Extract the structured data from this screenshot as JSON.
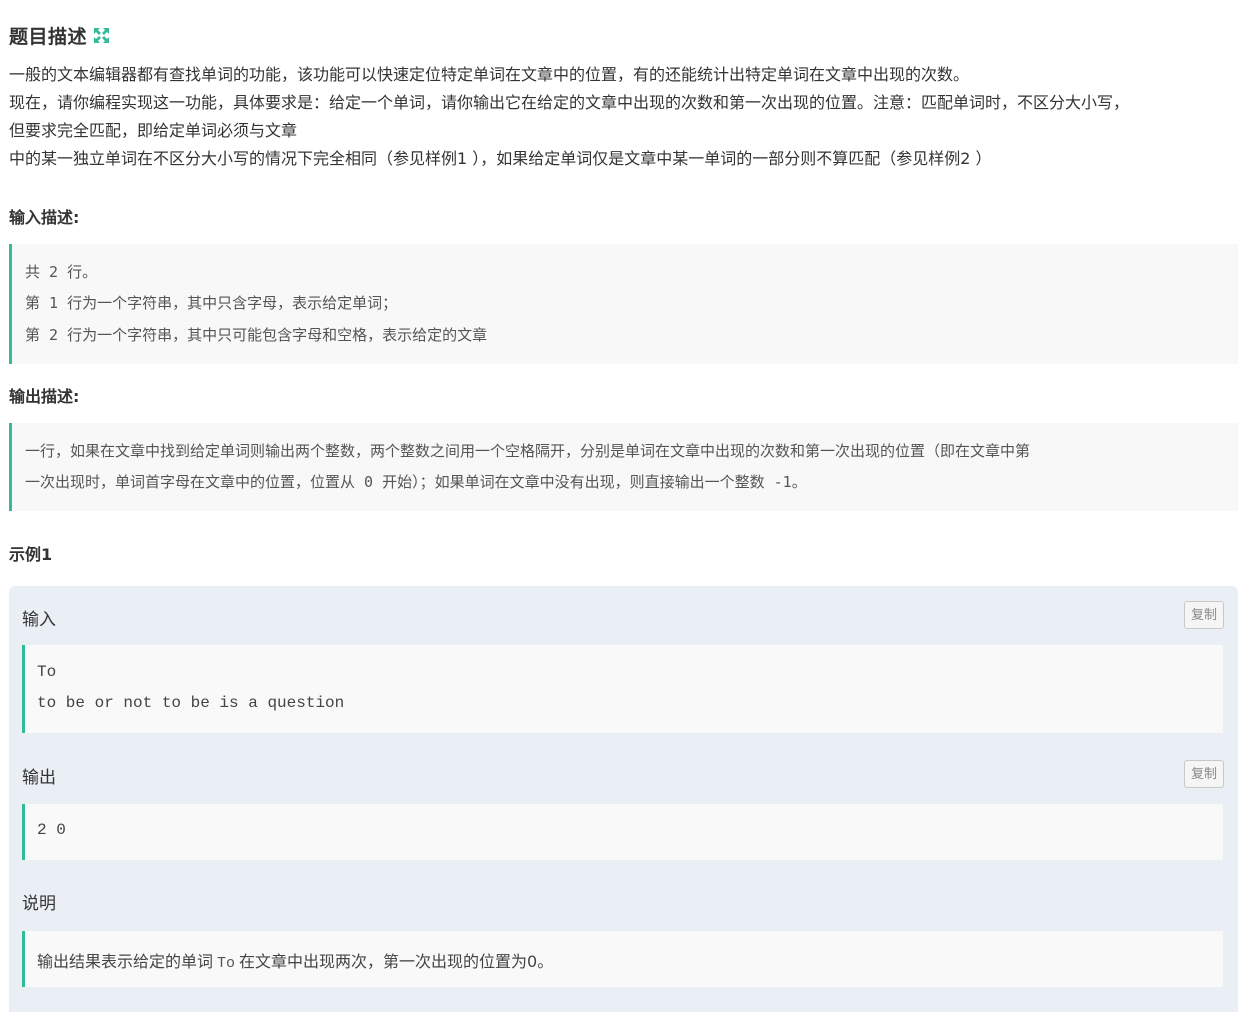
{
  "header": {
    "title": "题目描述",
    "expand_icon": "expand-arrows-icon",
    "accent_color": "#32ba9b"
  },
  "description": {
    "lines": [
      "一般的文本编辑器都有查找单词的功能，该功能可以快速定位特定单词在文章中的位置，有的还能统计出特定单词在文章中出现的次数。",
      "现在，请你编程实现这一功能，具体要求是：给定一个单词，请你输出它在给定的文章中出现的次数和第一次出现的位置。注意：匹配单词时，不区分大小写，",
      "但要求完全匹配，即给定单词必须与文章",
      "中的某一独立单词在不区分大小写的情况下完全相同（参见样例1 ），如果给定单词仅是文章中某一单词的一部分则不算匹配（参见样例2 ）"
    ]
  },
  "input_section": {
    "title": "输入描述:",
    "lines": [
      "共 2 行。",
      "第 1 行为一个字符串，其中只含字母，表示给定单词；",
      "第 2 行为一个字符串，其中只可能包含字母和空格，表示给定的文章"
    ]
  },
  "output_section": {
    "title": "输出描述:",
    "lines": [
      "一行，如果在文章中找到给定单词则输出两个整数，两个整数之间用一个空格隔开，分别是单词在文章中出现的次数和第一次出现的位置（即在文章中第",
      "一次出现时，单词首字母在文章中的位置，位置从 0 开始）；如果单词在文章中没有出现，则直接输出一个整数 -1。"
    ]
  },
  "example": {
    "title": "示例1",
    "input_label": "输入",
    "input_copy_label": "复制",
    "input_lines": [
      "To",
      "to be or not to be is a question"
    ],
    "output_label": "输出",
    "output_copy_label": "复制",
    "output_lines": [
      "2 0"
    ],
    "explain_label": "说明",
    "explain": {
      "before": "输出结果表示给定的单词",
      "code": "To",
      "after": "在文章中出现两次，第一次出现的位置为0。"
    }
  }
}
